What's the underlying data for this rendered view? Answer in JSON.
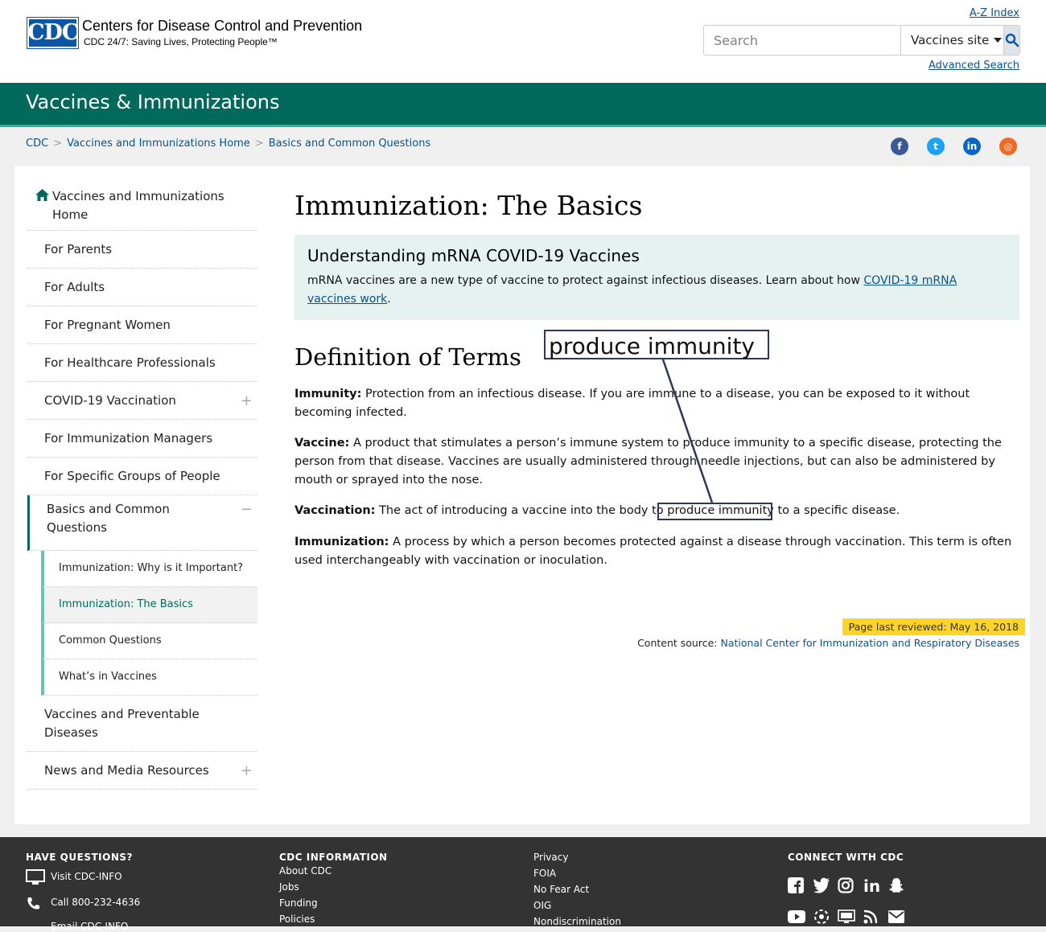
{
  "header": {
    "logo_text": "CDC",
    "org_title": "Centers for Disease Control and Prevention",
    "tagline": "CDC 24/7: Saving Lives, Protecting People™",
    "az_index": "A-Z Index",
    "search_placeholder": "Search",
    "site_scope": "Vaccines site",
    "advanced_search": "Advanced Search"
  },
  "band": {
    "title": "Vaccines & Immunizations"
  },
  "breadcrumb": {
    "items": [
      "CDC",
      "Vaccines and Immunizations Home",
      "Basics and Common Questions"
    ],
    "separator": ">"
  },
  "social": {
    "icons": [
      "facebook-icon",
      "twitter-icon",
      "linkedin-icon",
      "syndicate-icon"
    ],
    "colors": [
      "#3b5998",
      "#1da1f2",
      "#0a66c2",
      "#f26722"
    ]
  },
  "nav": {
    "home_label": "Vaccines and Immunizations Home",
    "items": [
      {
        "label": "For Parents"
      },
      {
        "label": "For Adults"
      },
      {
        "label": "For Pregnant Women"
      },
      {
        "label": "For Healthcare Professionals"
      },
      {
        "label": "COVID-19 Vaccination",
        "expand": "+"
      },
      {
        "label": "For Immunization Managers"
      },
      {
        "label": "For Specific Groups of People"
      },
      {
        "label": "Basics and Common Questions",
        "expand": "−"
      }
    ],
    "subitems": [
      {
        "label": "Immunization: Why is it Important?"
      },
      {
        "label": "Immunization: The Basics",
        "active": true
      },
      {
        "label": "Common Questions"
      },
      {
        "label": "What’s in Vaccines"
      }
    ],
    "after_items": [
      {
        "label": "Vaccines and Preventable Diseases"
      },
      {
        "label": "News and Media Resources",
        "expand": "+"
      }
    ]
  },
  "main": {
    "title": "Immunization: The Basics",
    "callout": {
      "title": "Understanding mRNA COVID-19 Vaccines",
      "text": "mRNA vaccines are a new type of vaccine to protect against infectious diseases. Learn about how ",
      "link": "COVID-19 mRNA vaccines work",
      "end": "."
    },
    "section_title": "Definition of Terms",
    "terms": [
      {
        "term": "Immunity:",
        "def": " Protection from an infectious disease. If you are immune to a disease, you can be exposed to it without becoming infected."
      },
      {
        "term": "Vaccine:",
        "def": " A product that stimulates a person’s immune system to produce immunity to a specific disease, protecting the person from that disease. Vaccines are usually administered through needle injections, but can also be administered by mouth or sprayed into the nose."
      },
      {
        "term": "Vaccination:",
        "def": " The act of introducing a vaccine into the body to produce immunity to a specific disease."
      },
      {
        "term": "Immunization:",
        "def": " A process by which a person becomes protected against a disease through vaccination. This term is often used interchangeably with vaccination or inoculation."
      }
    ],
    "reviewed": "Page last reviewed: May 16, 2018",
    "source_label": "Content source: ",
    "source_link": "National Center for Immunization and Respiratory Diseases"
  },
  "annotation": {
    "label": "produce immunity"
  },
  "footer": {
    "have_questions": "HAVE QUESTIONS?",
    "visit": "Visit CDC-INFO",
    "call": "Call 800-232-4636",
    "email": "Email CDC-INFO",
    "cdc_info": "CDC INFORMATION",
    "info_links": [
      "About CDC",
      "Jobs",
      "Funding",
      "Policies"
    ],
    "links2": [
      "Privacy",
      "FOIA",
      "No Fear Act",
      "OIG",
      "Nondiscrimination"
    ],
    "connect": "CONNECT WITH CDC"
  }
}
